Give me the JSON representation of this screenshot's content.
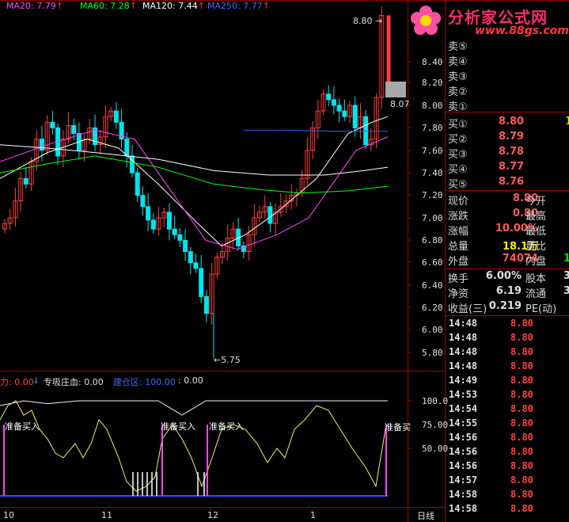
{
  "ma_bar": [
    {
      "label": "MA20: 7.79",
      "arrow": "↑",
      "color": "#ff44ff"
    },
    {
      "label": "MA60: 7.28",
      "arrow": "↑",
      "color": "#00ff00"
    },
    {
      "label": "MA120: 7.44",
      "arrow": "↑",
      "color": "#ffffff"
    },
    {
      "label": "MA250: 7.77",
      "arrow": "↑",
      "color": "#3060ff"
    }
  ],
  "ma_partial_left": "",
  "logo": {
    "cn": "分析家公式网",
    "url": "www.88gs.com"
  },
  "price_axis": [
    "8.40",
    "8.20",
    "8.00",
    "7.80",
    "7.60",
    "7.40",
    "7.20",
    "7.00",
    "6.80",
    "6.60",
    "6.40",
    "6.20",
    "6.00",
    "5.80"
  ],
  "price_marks": {
    "high": "8.80",
    "low": "5.75",
    "current": "8.07"
  },
  "month_labels": [
    "10",
    "11",
    "12",
    "1"
  ],
  "period_label": "日线",
  "indicator": {
    "left_label": "力: 0.00",
    "arrow": "↓",
    "name_label": "专吸庄血: 0.00",
    "zone_label": "建仓区: 100.00",
    "zone_value": ": 0.00",
    "axis": [
      "100.0",
      "75.00",
      "50.00"
    ],
    "signals": [
      "准备买入",
      "准备买入",
      "准备买入",
      "准备买"
    ]
  },
  "order_book": {
    "sells": [
      {
        "label": "卖⑤",
        "price": "",
        "vol": ""
      },
      {
        "label": "卖④",
        "price": "",
        "vol": ""
      },
      {
        "label": "卖③",
        "price": "",
        "vol": ""
      },
      {
        "label": "卖②",
        "price": "",
        "vol": ""
      },
      {
        "label": "卖①",
        "price": "",
        "vol": ""
      }
    ],
    "buys": [
      {
        "label": "买①",
        "price": "8.80",
        "vol": "1"
      },
      {
        "label": "买②",
        "price": "8.79",
        "vol": ""
      },
      {
        "label": "买③",
        "price": "8.78",
        "vol": ""
      },
      {
        "label": "买④",
        "price": "8.77",
        "vol": ""
      },
      {
        "label": "买⑤",
        "price": "8.76",
        "vol": ""
      }
    ]
  },
  "quote": [
    {
      "l1": "现价",
      "v1": "8.80",
      "c1": "red",
      "l2": "今开",
      "v2": ""
    },
    {
      "l1": "涨跌",
      "v1": "0.80",
      "c1": "red",
      "l2": "最高",
      "v2": ""
    },
    {
      "l1": "涨幅",
      "v1": "10.00%",
      "c1": "red",
      "l2": "最低",
      "v2": ""
    },
    {
      "l1": "总量",
      "v1": "18.1万",
      "c1": "yel",
      "l2": "量比",
      "v2": ""
    },
    {
      "l1": "外盘",
      "v1": "74074",
      "c1": "red",
      "l2": "内盘",
      "v2": "1"
    }
  ],
  "stats": [
    {
      "l1": "换手",
      "v1": "6.00%",
      "l2": "股本",
      "v2": "3"
    },
    {
      "l1": "净资",
      "v1": "6.19",
      "l2": "流通",
      "v2": "3"
    },
    {
      "l1": "收益(三)",
      "v1": "0.219",
      "l2": "PE(动)",
      "v2": ""
    }
  ],
  "ticks": [
    {
      "time": "14:48",
      "price": "8.80"
    },
    {
      "time": "14:48",
      "price": "8.80"
    },
    {
      "time": "14:48",
      "price": "8.80"
    },
    {
      "time": "14:48",
      "price": "8.80"
    },
    {
      "time": "14:49",
      "price": "8.80"
    },
    {
      "time": "14:53",
      "price": "8.80"
    },
    {
      "time": "14:54",
      "price": "8.80"
    },
    {
      "time": "14:55",
      "price": "8.80"
    },
    {
      "time": "14:56",
      "price": "8.80"
    },
    {
      "time": "14:56",
      "price": "8.80"
    },
    {
      "time": "14:56",
      "price": "8.80"
    },
    {
      "time": "14:57",
      "price": "8.80"
    },
    {
      "time": "14:58",
      "price": "8.80"
    },
    {
      "time": "14:58",
      "price": "8.80"
    }
  ],
  "colors": {
    "up": "#ff3c3c",
    "down": "#00e5ee",
    "grid": "#8b0000",
    "ma_white": "#ffffff",
    "ma_purple": "#ff44ff",
    "ma_green": "#00ff00",
    "ma_blue": "#3060ff"
  }
}
